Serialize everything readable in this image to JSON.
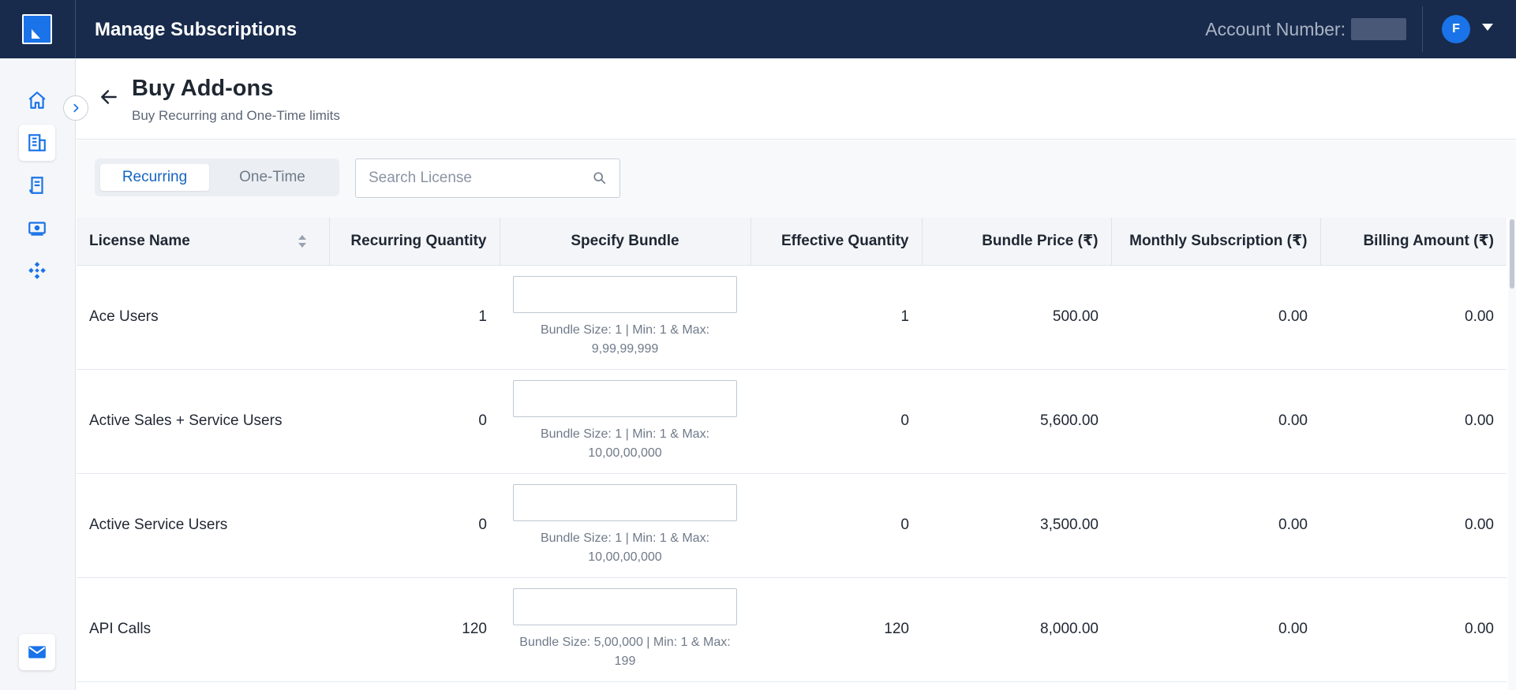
{
  "app": {
    "title": "Manage Subscriptions",
    "account_label": "Account Number:",
    "avatar_initial": "F"
  },
  "sidebar": {
    "items": [
      {
        "icon": "home-icon"
      },
      {
        "icon": "building-icon",
        "active": true
      },
      {
        "icon": "invoice-icon"
      },
      {
        "icon": "cash-icon"
      },
      {
        "icon": "network-icon"
      }
    ],
    "bottom_icon": "mail-icon"
  },
  "header": {
    "title": "Buy Add-ons",
    "subtitle": "Buy Recurring and One-Time limits"
  },
  "toolbar": {
    "tabs": [
      {
        "label": "Recurring",
        "active": true
      },
      {
        "label": "One-Time",
        "active": false
      }
    ],
    "search_placeholder": "Search License"
  },
  "table": {
    "columns": [
      "License Name",
      "Recurring Quantity",
      "Specify Bundle",
      "Effective Quantity",
      "Bundle Price (₹)",
      "Monthly Subscription (₹)",
      "Billing Amount (₹)"
    ],
    "rows": [
      {
        "name": "Ace Users",
        "recurring_qty": "1",
        "bundle_hint_1": "Bundle Size: 1 | Min: 1 & Max:",
        "bundle_hint_2": "9,99,99,999",
        "effective_qty": "1",
        "bundle_price": "500.00",
        "monthly": "0.00",
        "billing": "0.00"
      },
      {
        "name": "Active Sales + Service Users",
        "recurring_qty": "0",
        "bundle_hint_1": "Bundle Size: 1 | Min: 1 & Max:",
        "bundle_hint_2": "10,00,00,000",
        "effective_qty": "0",
        "bundle_price": "5,600.00",
        "monthly": "0.00",
        "billing": "0.00"
      },
      {
        "name": "Active Service Users",
        "recurring_qty": "0",
        "bundle_hint_1": "Bundle Size: 1 | Min: 1 & Max:",
        "bundle_hint_2": "10,00,00,000",
        "effective_qty": "0",
        "bundle_price": "3,500.00",
        "monthly": "0.00",
        "billing": "0.00"
      },
      {
        "name": "API Calls",
        "recurring_qty": "120",
        "bundle_hint_1": "Bundle Size: 5,00,000 | Min: 1 & Max:",
        "bundle_hint_2": "199",
        "effective_qty": "120",
        "bundle_price": "8,000.00",
        "monthly": "0.00",
        "billing": "0.00"
      }
    ]
  },
  "colors": {
    "topbar": "#182b4c",
    "accent": "#1a73e8",
    "active_tab_text": "#1565c0"
  }
}
